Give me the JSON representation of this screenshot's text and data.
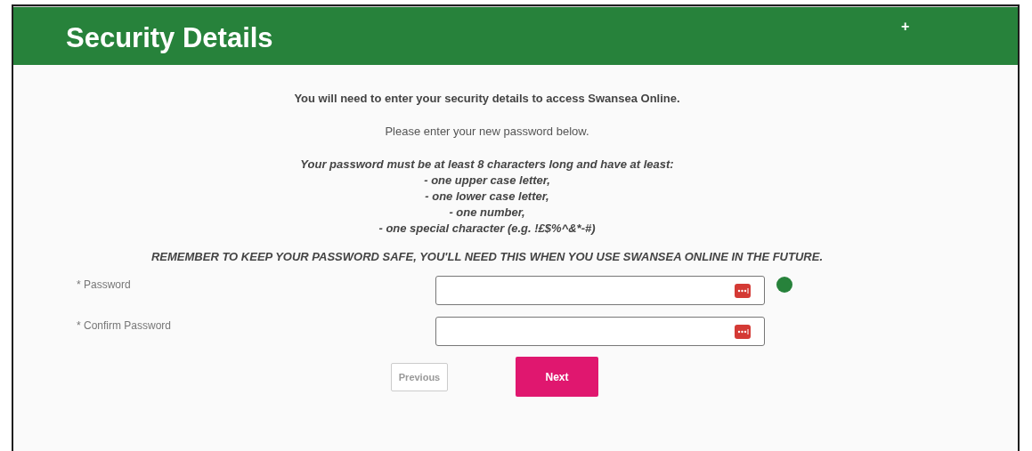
{
  "header": {
    "title": "Security Details",
    "add_symbol": "+"
  },
  "intro": {
    "heading": "You will need to enter your security details to access Swansea Online.",
    "instruction": "Please enter your new password below.",
    "rules": [
      "Your password must be at least 8 characters long and have at least:",
      "- one upper case letter,",
      "- one lower case letter,",
      "- one number,",
      "- one special character (e.g. !£$%^&*-#)"
    ],
    "reminder": "REMEMBER TO KEEP YOUR PASSWORD SAFE, YOU'LL NEED THIS WHEN YOU USE SWANSEA ONLINE IN THE FUTURE."
  },
  "fields": [
    {
      "label": "* Password",
      "status_dot": true
    },
    {
      "label": "* Confirm Password",
      "status_dot": false
    }
  ],
  "buttons": [
    {
      "label": "Previous",
      "kind": "secondary",
      "disabled": true
    },
    {
      "label": "Next",
      "kind": "primary",
      "disabled": false
    }
  ]
}
